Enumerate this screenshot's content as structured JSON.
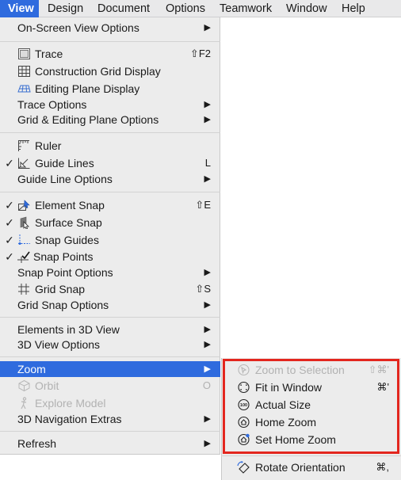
{
  "menubar": {
    "items": [
      {
        "label": "View"
      },
      {
        "label": "Design"
      },
      {
        "label": "Document"
      },
      {
        "label": "Options"
      },
      {
        "label": "Teamwork"
      },
      {
        "label": "Window"
      },
      {
        "label": "Help"
      }
    ]
  },
  "view_menu": {
    "on_screen_view_options": "On-Screen View Options",
    "trace": {
      "label": "Trace",
      "shortcut": "⇧F2"
    },
    "construction_grid_display": "Construction Grid Display",
    "editing_plane_display": "Editing Plane Display",
    "trace_options": "Trace Options",
    "grid_editing_plane_options": "Grid & Editing Plane Options",
    "ruler": "Ruler",
    "guide_lines": {
      "label": "Guide Lines",
      "shortcut": "L",
      "checked": true
    },
    "guide_line_options": "Guide Line Options",
    "element_snap": {
      "label": "Element Snap",
      "shortcut": "⇧E",
      "checked": true
    },
    "surface_snap": {
      "label": "Surface Snap",
      "checked": true
    },
    "snap_guides": {
      "label": "Snap Guides",
      "checked": true
    },
    "snap_points": {
      "label": "Snap Points",
      "checked": true
    },
    "snap_point_options": "Snap Point Options",
    "grid_snap": {
      "label": "Grid Snap",
      "shortcut": "⇧S"
    },
    "grid_snap_options": "Grid Snap Options",
    "elements_in_3d_view": "Elements in 3D View",
    "3d_view_options": "3D View Options",
    "zoom": "Zoom",
    "orbit": {
      "label": "Orbit",
      "shortcut": "O"
    },
    "explore_model": "Explore Model",
    "3d_navigation_extras": "3D Navigation Extras",
    "refresh": "Refresh",
    "check_mark": "✓",
    "submenu_arrow": "▶"
  },
  "zoom_submenu": {
    "zoom_to_selection": {
      "label": "Zoom to Selection",
      "shortcut": "⇧⌘'"
    },
    "fit_in_window": {
      "label": "Fit in Window",
      "shortcut": "⌘'"
    },
    "actual_size": {
      "label": "Actual Size"
    },
    "home_zoom": {
      "label": "Home Zoom"
    },
    "set_home_zoom": {
      "label": "Set Home Zoom"
    },
    "rotate_orientation": {
      "label": "Rotate Orientation",
      "shortcut": "⌘,"
    }
  },
  "colors": {
    "highlight": "#2f6bde",
    "annotation_box": "#e3261e",
    "menu_bg": "#ececec"
  },
  "icons": [
    "trace-icon",
    "grid-icon",
    "plane-icon",
    "ruler-icon",
    "guide-lines-icon",
    "element-snap-icon",
    "surface-snap-icon",
    "snap-guides-icon",
    "snap-points-icon",
    "grid-snap-icon",
    "orbit-icon",
    "explore-icon",
    "zoom-selection-icon",
    "fit-window-icon",
    "actual-size-icon",
    "home-zoom-icon",
    "set-home-zoom-icon",
    "rotate-icon"
  ]
}
